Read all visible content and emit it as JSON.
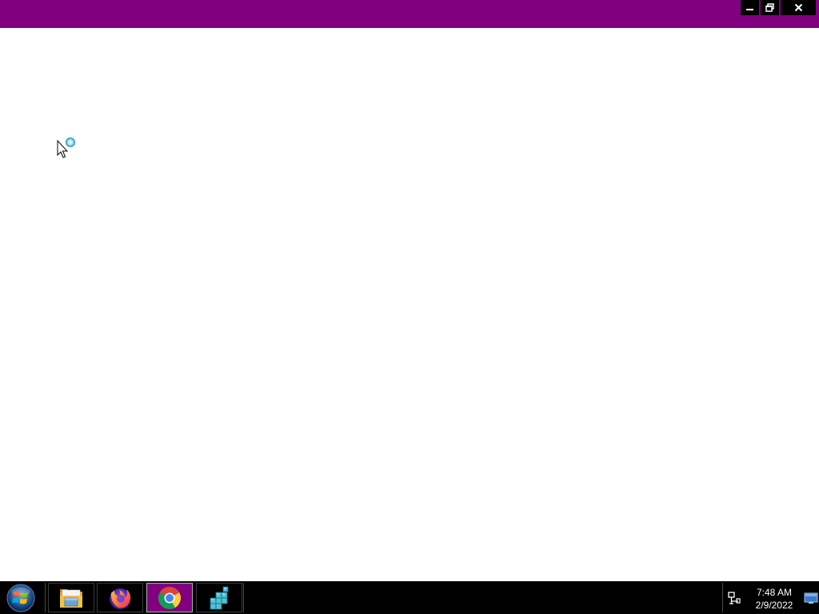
{
  "window": {
    "titlebar_color": "#800080",
    "controls": {
      "minimize_icon": "minimize-icon",
      "restore_icon": "restore-icon",
      "close_icon": "close-icon"
    }
  },
  "content": {
    "background": "#ffffff",
    "cursor": "busy-pointer-icon"
  },
  "taskbar": {
    "start_icon": "windows-logo-icon",
    "apps": [
      {
        "name": "File Explorer",
        "icon": "folder-icon",
        "active": false
      },
      {
        "name": "Firefox",
        "icon": "firefox-icon",
        "active": false
      },
      {
        "name": "Chrome",
        "icon": "chrome-icon",
        "active": true
      },
      {
        "name": "App",
        "icon": "cubes-icon",
        "active": false
      }
    ],
    "tray": {
      "network_icon": "network-icon",
      "time": "7:48 AM",
      "date": "2/9/2022",
      "show_desktop_icon": "show-desktop-icon"
    },
    "active_color": "#800080"
  }
}
